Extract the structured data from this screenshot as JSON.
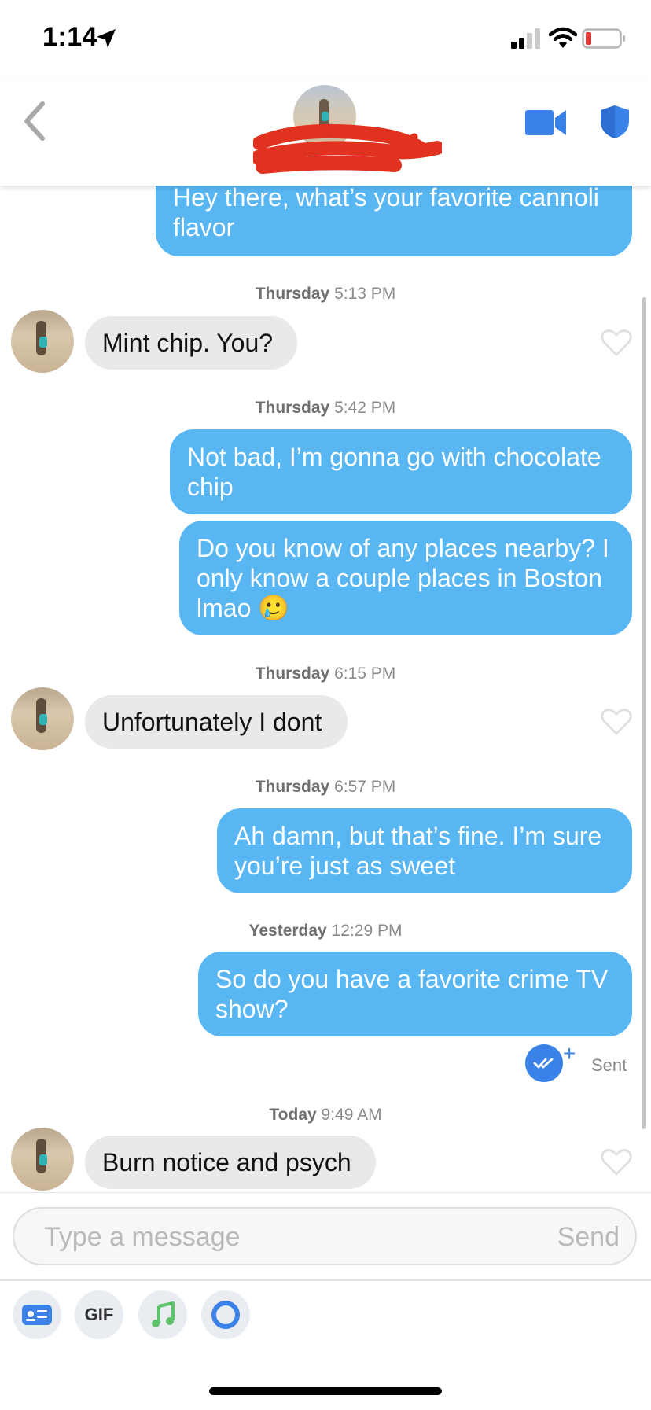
{
  "status_bar": {
    "time": "1:14"
  },
  "header": {
    "contact_name": ""
  },
  "messages": [
    {
      "direction": "out",
      "text": "Hey there, what’s your favorite cannoli flavor"
    },
    {
      "timestamp_day": "Thursday",
      "timestamp_time": "5:13 PM"
    },
    {
      "direction": "in",
      "text": "Mint chip. You?"
    },
    {
      "timestamp_day": "Thursday",
      "timestamp_time": "5:42 PM"
    },
    {
      "direction": "out",
      "text": "Not bad, I’m gonna go with chocolate chip"
    },
    {
      "direction": "out",
      "text": "Do you know of any places nearby? I only know a couple places in Boston lmao",
      "emoji": "🥲"
    },
    {
      "timestamp_day": "Thursday",
      "timestamp_time": "6:15 PM"
    },
    {
      "direction": "in",
      "text": "Unfortunately I dont"
    },
    {
      "timestamp_day": "Thursday",
      "timestamp_time": "6:57 PM"
    },
    {
      "direction": "out",
      "text": "Ah damn, but that’s fine. I’m sure you’re just as sweet"
    },
    {
      "timestamp_day": "Yesterday",
      "timestamp_time": "12:29 PM"
    },
    {
      "direction": "out",
      "text": "So do you have a favorite crime TV show?"
    },
    {
      "receipt": "Sent"
    },
    {
      "timestamp_day": "Today",
      "timestamp_time": "9:49 AM"
    },
    {
      "direction": "in",
      "text": "Burn notice and psych"
    }
  ],
  "composer": {
    "placeholder": "Type a message",
    "send_label": "Send"
  },
  "toolbar": {
    "gif_label": "GIF"
  },
  "colors": {
    "outgoing_bubble": "#58b6f2",
    "incoming_bubble": "#e9e9e9",
    "accent": "#3b82e8",
    "music": "#5cc36a"
  }
}
